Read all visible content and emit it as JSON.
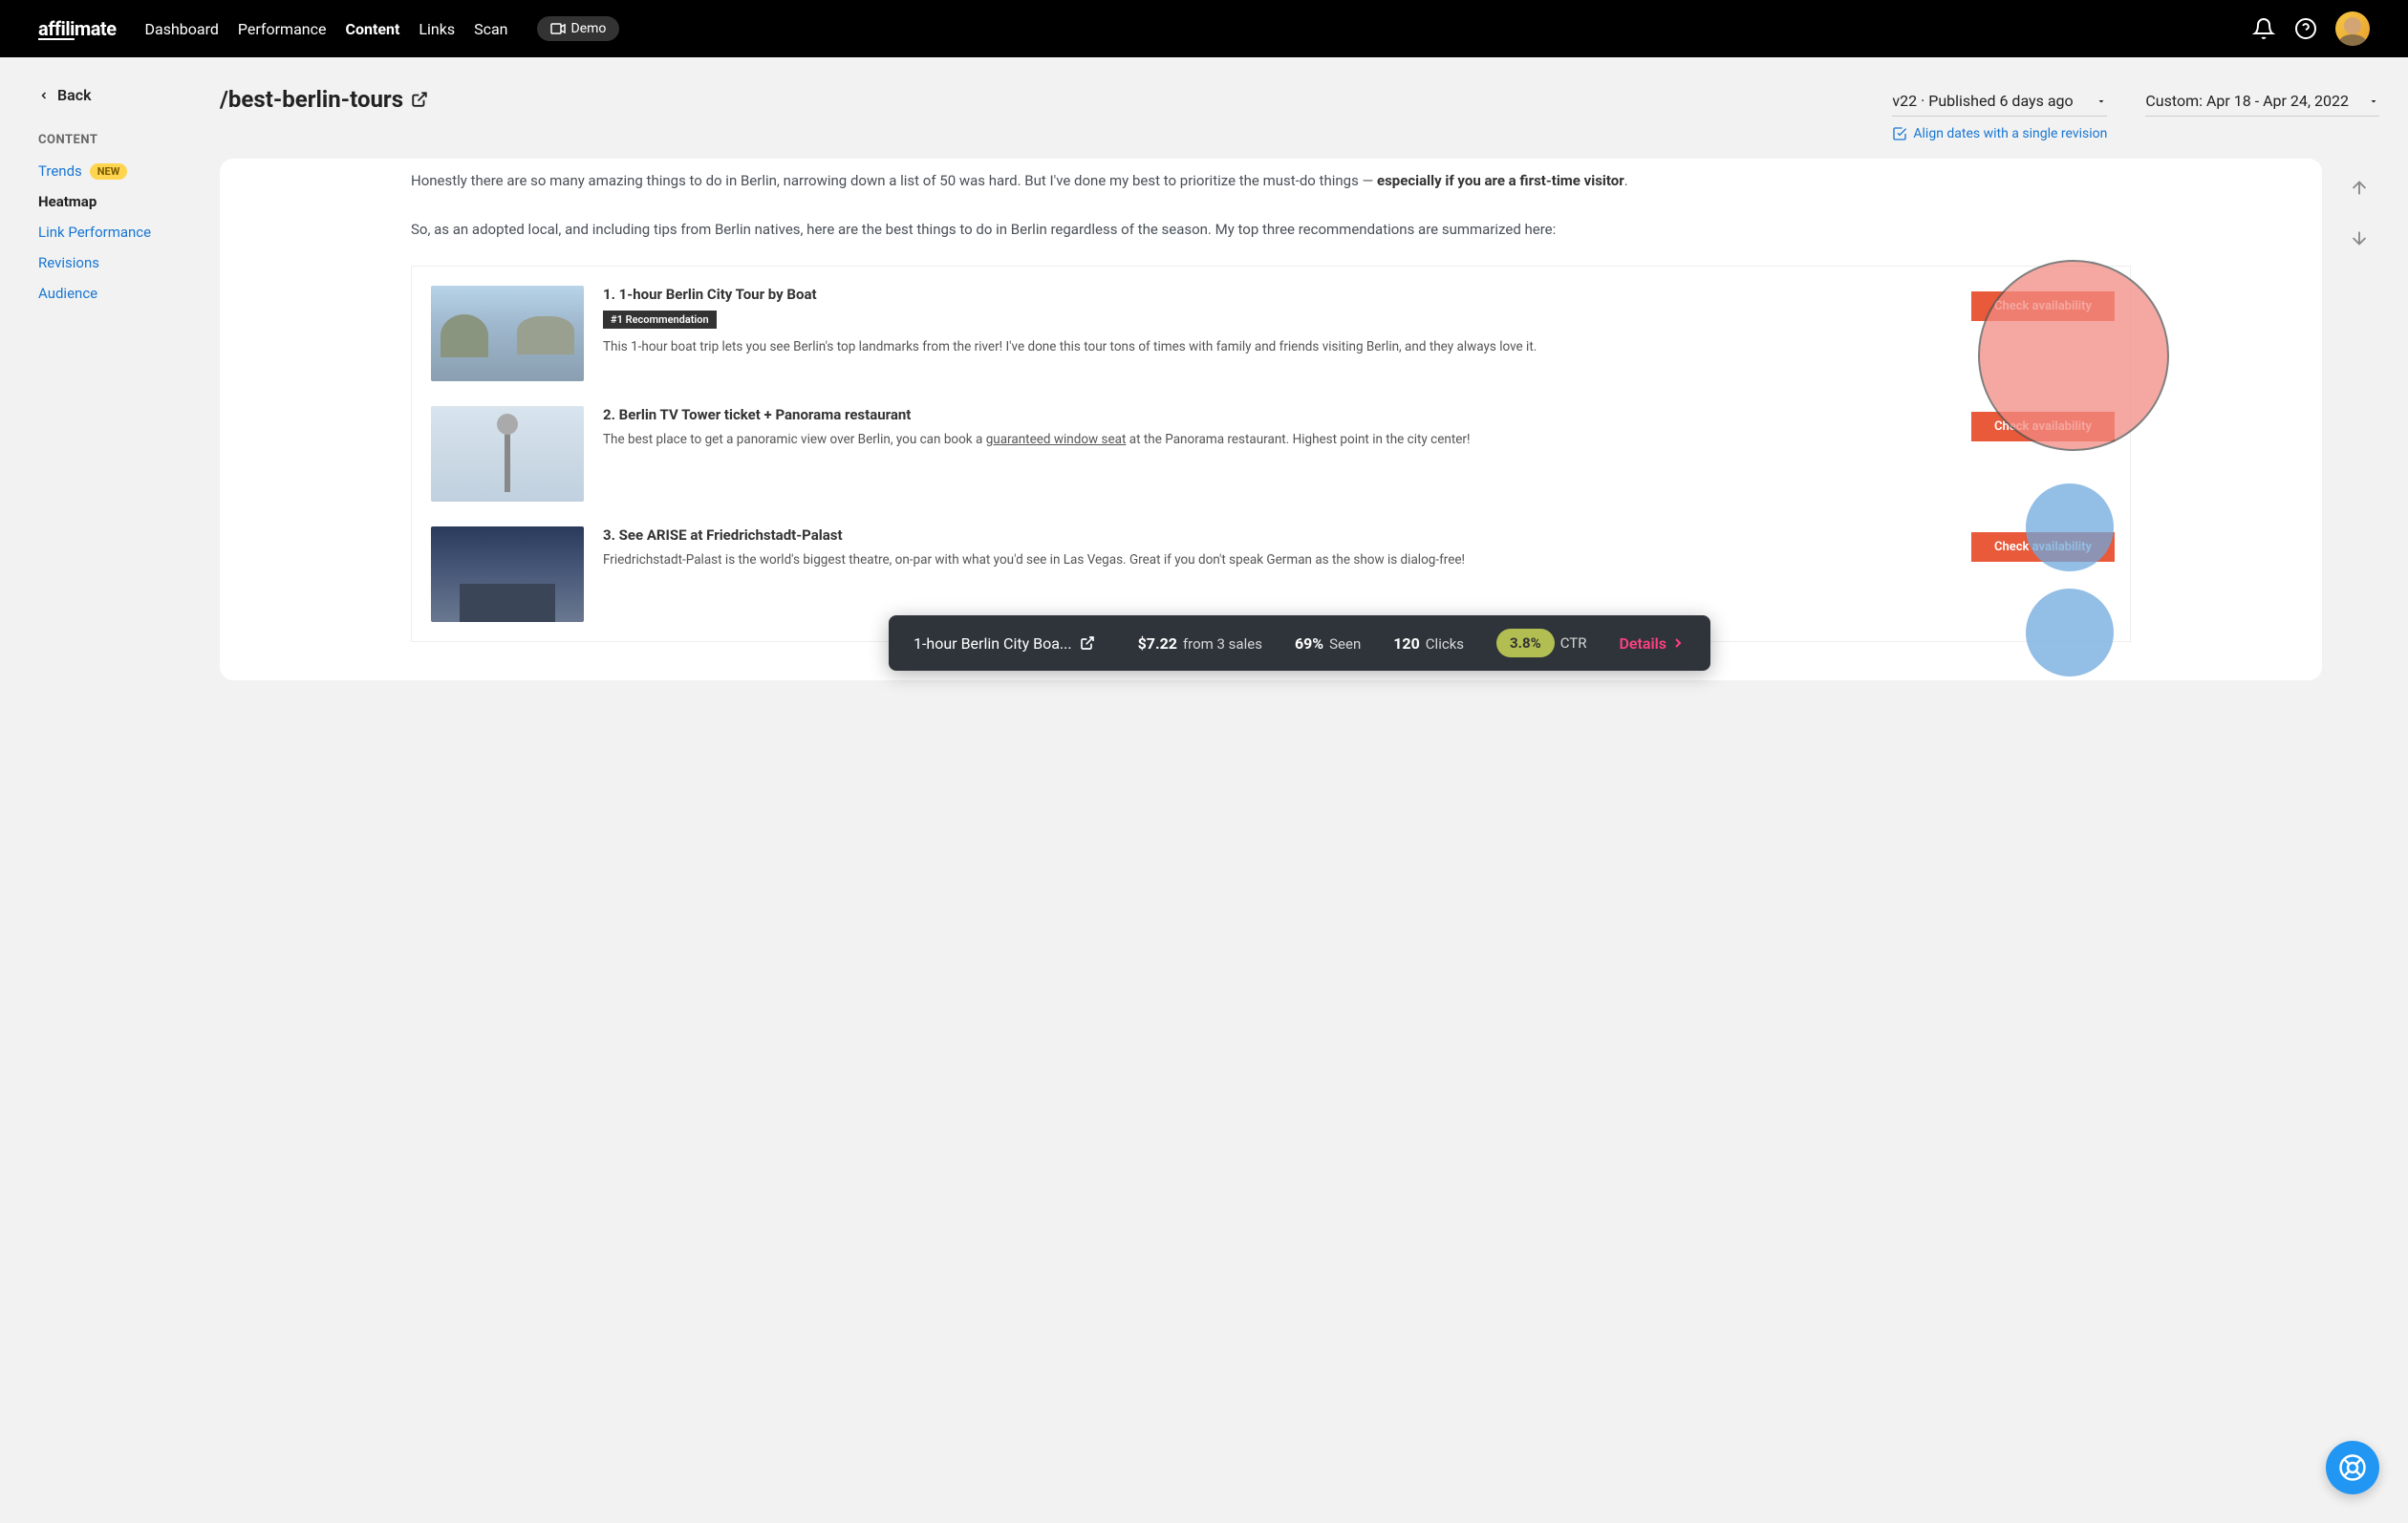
{
  "topbar": {
    "logo_prefix": "affili",
    "logo_suffix": "mate",
    "nav": [
      "Dashboard",
      "Performance",
      "Content",
      "Links",
      "Scan"
    ],
    "nav_active_index": 2,
    "demo_label": "Demo"
  },
  "sidebar": {
    "back_label": "Back",
    "section_label": "CONTENT",
    "items": [
      {
        "label": "Trends",
        "badge": "NEW"
      },
      {
        "label": "Heatmap",
        "active": true
      },
      {
        "label": "Link Performance"
      },
      {
        "label": "Revisions"
      },
      {
        "label": "Audience"
      }
    ]
  },
  "header": {
    "page_title": "/best-berlin-tours",
    "version_label": "v22 · Published 6 days ago",
    "date_range_label": "Custom: Apr 18 - Apr 24, 2022",
    "align_link": "Align dates with a single revision"
  },
  "article": {
    "para1_a": "Honestly there are so many amazing things to do in Berlin, narrowing down a list of 50 was hard. But I've done my best to prioritize the must-do things — ",
    "para1_b": "especially if you are a first-time visitor",
    "para1_c": ".",
    "para2": "So, as an adopted local, and including tips from Berlin natives, here are the best things to do in Berlin regardless of the season. My top three recommendations are summarized here:",
    "recs": [
      {
        "title": "1. 1-hour Berlin City Tour by Boat",
        "badge": "#1 Recommendation",
        "desc": "This 1-hour boat trip lets you see Berlin's top landmarks from the river! I've done this tour tons of times with family and friends visiting Berlin, and they always love it.",
        "cta": "Check availability"
      },
      {
        "title": "2. Berlin TV Tower ticket + Panorama restaurant",
        "desc_a": "The best place to get a panoramic view over Berlin, you can book a ",
        "desc_link": "guaranteed window seat",
        "desc_b": " at the Panorama restaurant. Highest point in the city center!",
        "cta": "Check availability"
      },
      {
        "title": "3. See ARISE at Friedrichstadt-Palast",
        "desc": "Friedrichstadt-Palast is the world's biggest theatre, on-par with what you'd see in Las Vegas. Great if you don't speak German as the show is dialog-free!",
        "cta": "Check availability"
      }
    ]
  },
  "bottom_bar": {
    "title": "1-hour Berlin City Boa...",
    "revenue": "$7.22",
    "revenue_sub": "from 3 sales",
    "seen_pct": "69%",
    "seen_label": "Seen",
    "clicks": "120",
    "clicks_label": "Clicks",
    "ctr": "3.8%",
    "ctr_label": "CTR",
    "details_label": "Details"
  }
}
